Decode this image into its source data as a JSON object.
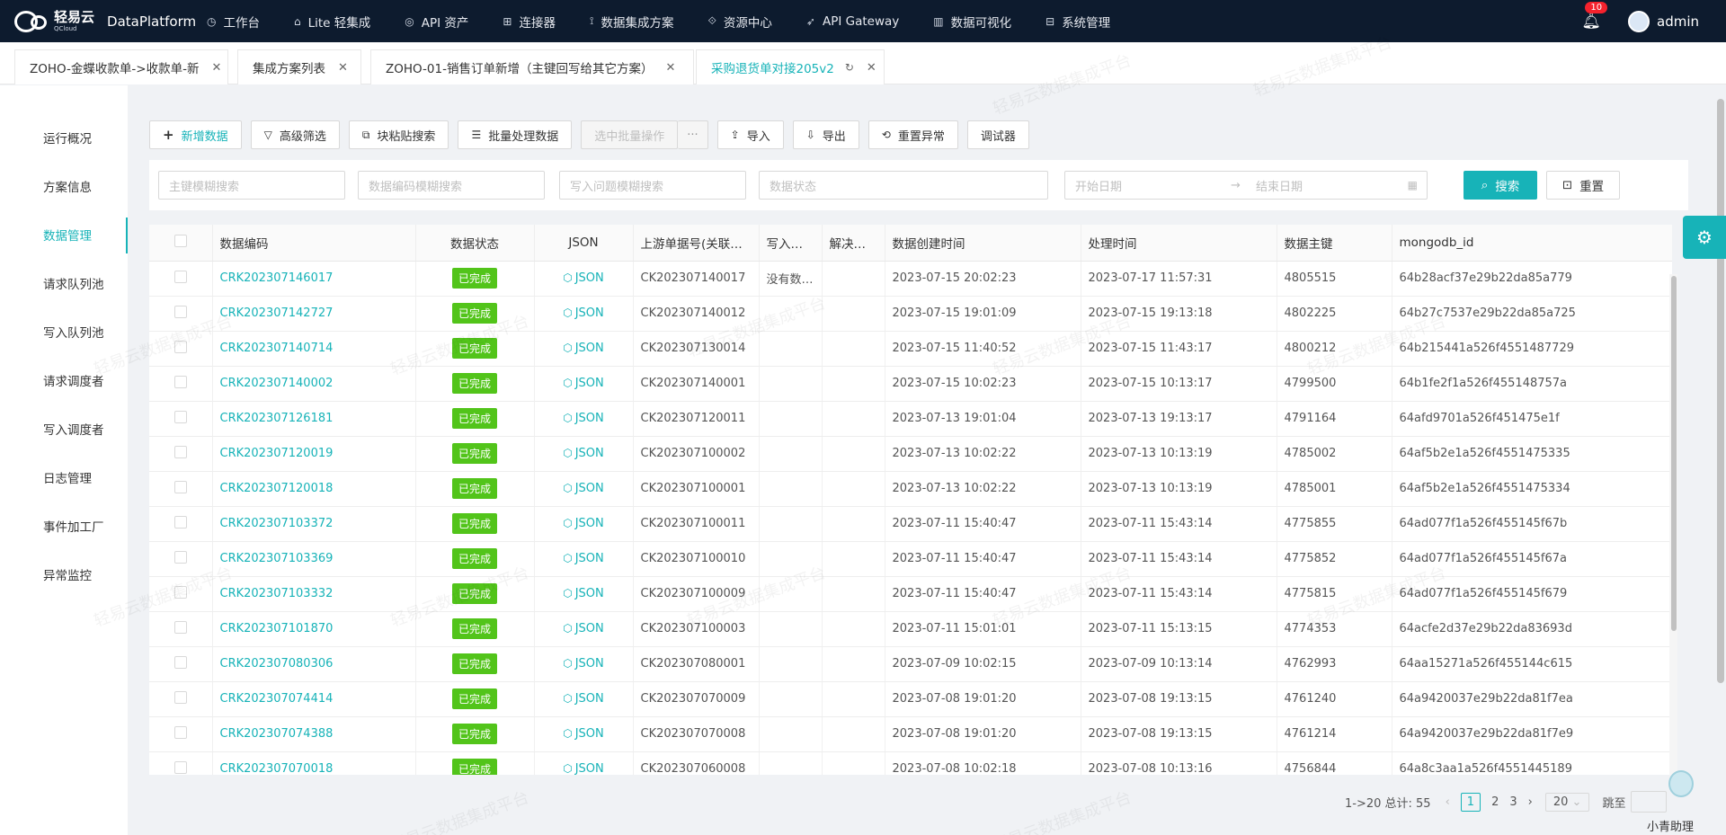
{
  "app": {
    "logo_cn": "轻易云",
    "logo_en": "QCloud",
    "brand": "DataPlatform"
  },
  "nav": [
    {
      "icon": "clock-icon",
      "glyph": "◷",
      "label": "工作台"
    },
    {
      "icon": "house-icon",
      "glyph": "⌂",
      "label": "Lite 轻集成"
    },
    {
      "icon": "compass-icon",
      "glyph": "◎",
      "label": "API 资产"
    },
    {
      "icon": "connector-icon",
      "glyph": "⊞",
      "label": "连接器"
    },
    {
      "icon": "sitemap-icon",
      "glyph": "⟟",
      "label": "数据集成方案"
    },
    {
      "icon": "resource-icon",
      "glyph": "⟐",
      "label": "资源中心"
    },
    {
      "icon": "rocket-icon",
      "glyph": "➶",
      "label": "API Gateway"
    },
    {
      "icon": "chart-icon",
      "glyph": "▥",
      "label": "数据可视化"
    },
    {
      "icon": "grid-icon",
      "glyph": "⊟",
      "label": "系统管理"
    }
  ],
  "user": {
    "badge": "10",
    "name": "admin"
  },
  "tabs": [
    {
      "label": "ZOHO-金蝶收款单->收款单-新"
    },
    {
      "label": "集成方案列表"
    },
    {
      "label": "ZOHO-01-销售订单新增（主键回写给其它方案）"
    },
    {
      "label": "采购退货单对接205v2"
    }
  ],
  "sidebar": [
    {
      "label": "运行概况"
    },
    {
      "label": "方案信息"
    },
    {
      "label": "数据管理"
    },
    {
      "label": "请求队列池"
    },
    {
      "label": "写入队列池"
    },
    {
      "label": "请求调度者"
    },
    {
      "label": "写入调度者"
    },
    {
      "label": "日志管理"
    },
    {
      "label": "事件加工厂"
    },
    {
      "label": "异常监控"
    }
  ],
  "toolbar": {
    "add": "新增数据",
    "filter": "高级筛选",
    "paste_search": "块粘贴搜索",
    "batch": "批量处理数据",
    "selected_batch": "选中批量操作",
    "more": "···",
    "import": "导入",
    "export": "导出",
    "reset_error": "重置异常",
    "debugger": "调试器"
  },
  "filters": {
    "pk_placeholder": "主键模糊搜索",
    "code_placeholder": "数据编码模糊搜索",
    "issue_placeholder": "写入问题模糊搜索",
    "status_placeholder": "数据状态",
    "start_date": "开始日期",
    "arrow": "→",
    "end_date": "结束日期",
    "search": "搜索",
    "reset": "重置"
  },
  "table": {
    "headers": [
      "数据编码",
      "数据状态",
      "JSON",
      "上游单据号(关联…",
      "写入…",
      "解决…",
      "数据创建时间",
      "处理时间",
      "数据主键",
      "mongodb_id"
    ],
    "rows": [
      {
        "code": "CRK202307146017",
        "status": "已完成",
        "json": "JSON",
        "upstream": "CK202307140017",
        "write": "没有数…",
        "resolve": "",
        "created": "2023-07-15 20:02:23",
        "processed": "2023-07-17 11:57:31",
        "pk": "4805515",
        "mongo": "64b28acf37e29b22da85a779"
      },
      {
        "code": "CRK202307142727",
        "status": "已完成",
        "json": "JSON",
        "upstream": "CK202307140012",
        "write": "",
        "resolve": "",
        "created": "2023-07-15 19:01:09",
        "processed": "2023-07-15 19:13:18",
        "pk": "4802225",
        "mongo": "64b27c7537e29b22da85a725"
      },
      {
        "code": "CRK202307140714",
        "status": "已完成",
        "json": "JSON",
        "upstream": "CK202307130014",
        "write": "",
        "resolve": "",
        "created": "2023-07-15 11:40:52",
        "processed": "2023-07-15 11:43:17",
        "pk": "4800212",
        "mongo": "64b215441a526f4551487729"
      },
      {
        "code": "CRK202307140002",
        "status": "已完成",
        "json": "JSON",
        "upstream": "CK202307140001",
        "write": "",
        "resolve": "",
        "created": "2023-07-15 10:02:23",
        "processed": "2023-07-15 10:13:17",
        "pk": "4799500",
        "mongo": "64b1fe2f1a526f455148757a"
      },
      {
        "code": "CRK202307126181",
        "status": "已完成",
        "json": "JSON",
        "upstream": "CK202307120011",
        "write": "",
        "resolve": "",
        "created": "2023-07-13 19:01:04",
        "processed": "2023-07-13 19:13:17",
        "pk": "4791164",
        "mongo": "64afd9701a526f451475e1f"
      },
      {
        "code": "CRK202307120019",
        "status": "已完成",
        "json": "JSON",
        "upstream": "CK202307100002",
        "write": "",
        "resolve": "",
        "created": "2023-07-13 10:02:22",
        "processed": "2023-07-13 10:13:19",
        "pk": "4785002",
        "mongo": "64af5b2e1a526f4551475335"
      },
      {
        "code": "CRK202307120018",
        "status": "已完成",
        "json": "JSON",
        "upstream": "CK202307100001",
        "write": "",
        "resolve": "",
        "created": "2023-07-13 10:02:22",
        "processed": "2023-07-13 10:13:19",
        "pk": "4785001",
        "mongo": "64af5b2e1a526f4551475334"
      },
      {
        "code": "CRK202307103372",
        "status": "已完成",
        "json": "JSON",
        "upstream": "CK202307100011",
        "write": "",
        "resolve": "",
        "created": "2023-07-11 15:40:47",
        "processed": "2023-07-11 15:43:14",
        "pk": "4775855",
        "mongo": "64ad077f1a526f455145f67b"
      },
      {
        "code": "CRK202307103369",
        "status": "已完成",
        "json": "JSON",
        "upstream": "CK202307100010",
        "write": "",
        "resolve": "",
        "created": "2023-07-11 15:40:47",
        "processed": "2023-07-11 15:43:14",
        "pk": "4775852",
        "mongo": "64ad077f1a526f455145f67a"
      },
      {
        "code": "CRK202307103332",
        "status": "已完成",
        "json": "JSON",
        "upstream": "CK202307100009",
        "write": "",
        "resolve": "",
        "created": "2023-07-11 15:40:47",
        "processed": "2023-07-11 15:43:14",
        "pk": "4775815",
        "mongo": "64ad077f1a526f455145f679"
      },
      {
        "code": "CRK202307101870",
        "status": "已完成",
        "json": "JSON",
        "upstream": "CK202307100003",
        "write": "",
        "resolve": "",
        "created": "2023-07-11 15:01:01",
        "processed": "2023-07-11 15:13:15",
        "pk": "4774353",
        "mongo": "64acfe2d37e29b22da83693d"
      },
      {
        "code": "CRK202307080306",
        "status": "已完成",
        "json": "JSON",
        "upstream": "CK202307080001",
        "write": "",
        "resolve": "",
        "created": "2023-07-09 10:02:15",
        "processed": "2023-07-09 10:13:14",
        "pk": "4762993",
        "mongo": "64aa15271a526f455144c615"
      },
      {
        "code": "CRK202307074414",
        "status": "已完成",
        "json": "JSON",
        "upstream": "CK202307070009",
        "write": "",
        "resolve": "",
        "created": "2023-07-08 19:01:20",
        "processed": "2023-07-08 19:13:15",
        "pk": "4761240",
        "mongo": "64a9420037e29b22da81f7ea"
      },
      {
        "code": "CRK202307074388",
        "status": "已完成",
        "json": "JSON",
        "upstream": "CK202307070008",
        "write": "",
        "resolve": "",
        "created": "2023-07-08 19:01:20",
        "processed": "2023-07-08 19:13:15",
        "pk": "4761214",
        "mongo": "64a9420037e29b22da81f7e9"
      },
      {
        "code": "CRK202307070018",
        "status": "已完成",
        "json": "JSON",
        "upstream": "CK202307060008",
        "write": "",
        "resolve": "",
        "created": "2023-07-08 10:02:18",
        "processed": "2023-07-08 10:13:16",
        "pk": "4756844",
        "mongo": "64a8c3aa1a526f4551445189"
      }
    ]
  },
  "pagination": {
    "summary": "1->20 总计: 55",
    "prev": "‹",
    "pages": [
      "1",
      "2",
      "3"
    ],
    "next": "›",
    "page_size": "20",
    "goto": "跳至"
  },
  "assistant": {
    "label": "小青助理"
  },
  "watermark": "轻易云数据集成平台",
  "colors": {
    "accent": "#17b3b8",
    "nav_bg": "#0d1b2e",
    "status_done": "#52c41a"
  }
}
